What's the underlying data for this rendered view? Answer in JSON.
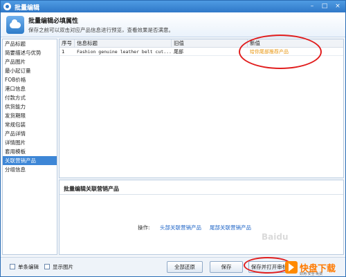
{
  "window": {
    "title": "批量编辑",
    "controls": {
      "minimize": "–",
      "maximize": "□",
      "close": "×"
    }
  },
  "header": {
    "title": "批量编辑必填属性",
    "subtitle": "保存之前可以双击对应产品信息进行预览，查看效果是否满意。",
    "icon": "cloud-icon"
  },
  "sidebar": {
    "items": [
      {
        "label": "产品标题"
      },
      {
        "label": "简要描述与优势"
      },
      {
        "label": "产品图片"
      },
      {
        "label": "最小起订量"
      },
      {
        "label": "FOB价格"
      },
      {
        "label": "港口信息"
      },
      {
        "label": "付款方式"
      },
      {
        "label": "供货能力"
      },
      {
        "label": "发货期限"
      },
      {
        "label": "常规包装"
      },
      {
        "label": "产品详情"
      },
      {
        "label": "详情图片"
      },
      {
        "label": "套用模板"
      },
      {
        "label": "关联营销产品"
      },
      {
        "label": "分组信息"
      }
    ],
    "active_index": 13
  },
  "table": {
    "columns": [
      "序号",
      "信息标题",
      "旧值",
      "新值"
    ],
    "rows": [
      {
        "index": "1",
        "title": "Fashion genuine leather belt cut...",
        "old_value": "尾部",
        "new_value": "给你尾部推荐产品"
      }
    ]
  },
  "panel": {
    "title": "批量编辑关联营销产品",
    "operation_label": "操作:",
    "links": [
      "头部关联营销产品",
      "尾部关联营销产品"
    ]
  },
  "footer": {
    "checkbox_single_edit": "单条编辑",
    "checkbox_show_images": "显示图片",
    "btn_restore_all": "全部还原",
    "btn_save": "保存",
    "btn_save_open": "保存并打开审核"
  },
  "watermark": {
    "logo_text": "快盘下载",
    "logo_sub": "好用·安全·免费"
  },
  "colors": {
    "accent": "#2f78c8",
    "selection": "#3d86d6",
    "new_value": "#e8960f",
    "link": "#1a62c6",
    "annotation": "#e11d1d"
  }
}
